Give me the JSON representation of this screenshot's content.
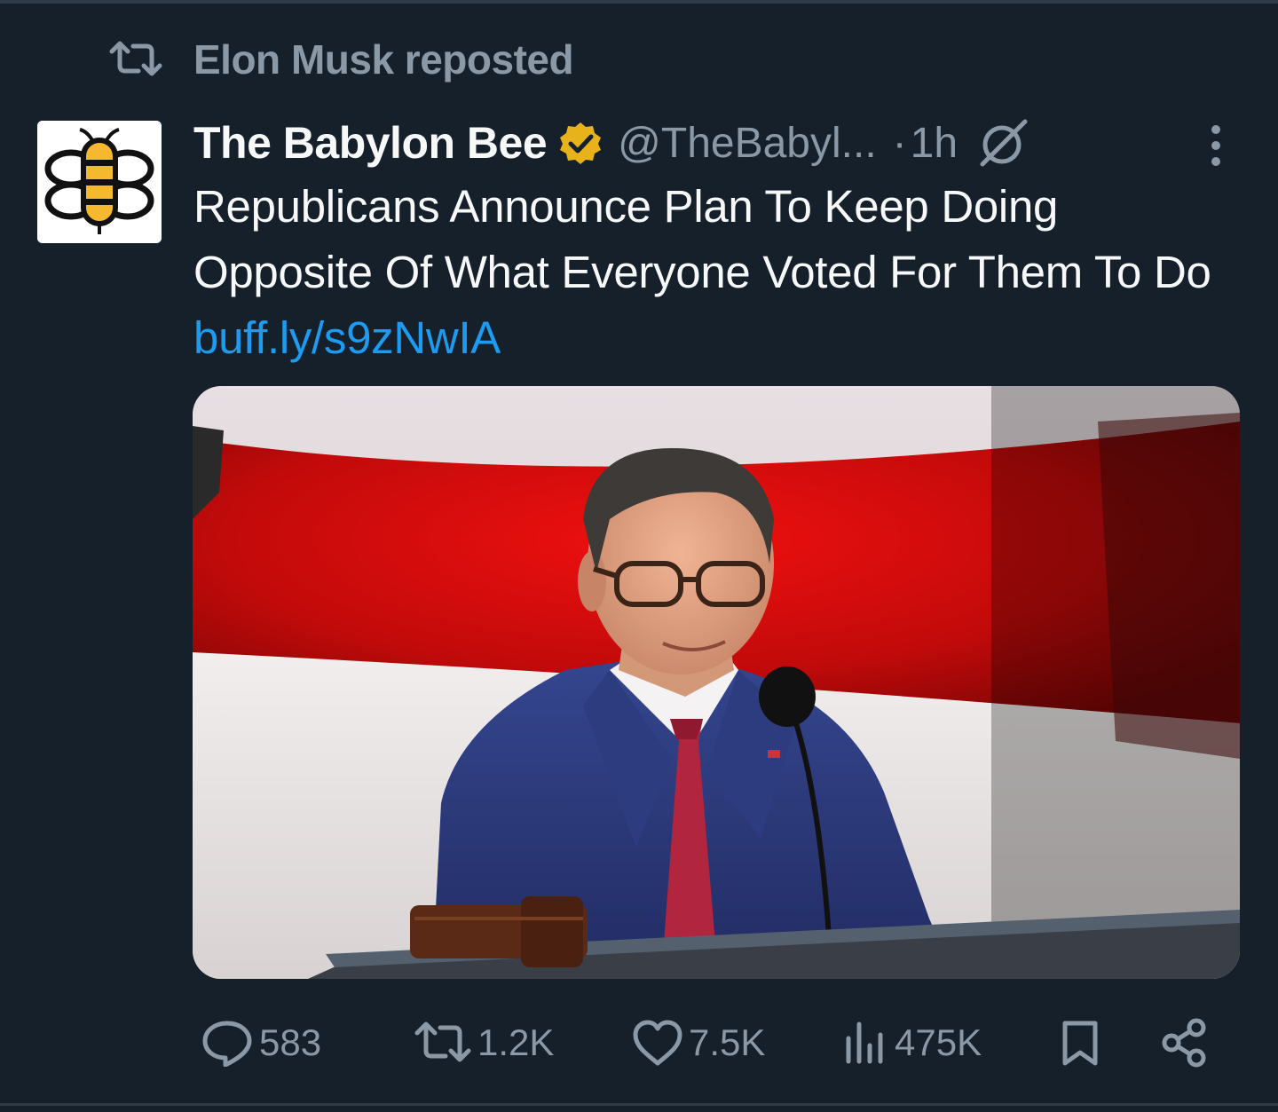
{
  "repost": {
    "label": "Elon Musk reposted",
    "icon": "repost-icon"
  },
  "post": {
    "author_name": "The Babylon Bee",
    "handle": "@TheBabyl...",
    "separator": "·",
    "time": "1h",
    "text": "Republicans Announce Plan To Keep Doing Opposite Of What Everyone Voted For Them To Do ",
    "link": "buff.ly/s9zNwIA",
    "avatar_icon": "babylon-bee-logo",
    "media_description": "Man in blue suit with glasses at podium with gavel in front of red and white flag backdrop"
  },
  "stats": {
    "replies": "583",
    "reposts": "1.2K",
    "likes": "7.5K",
    "views": "475K"
  },
  "colors": {
    "background": "#15202b",
    "muted": "#8b98a5",
    "link": "#1d9bf0",
    "verified": "#e8b31a"
  }
}
